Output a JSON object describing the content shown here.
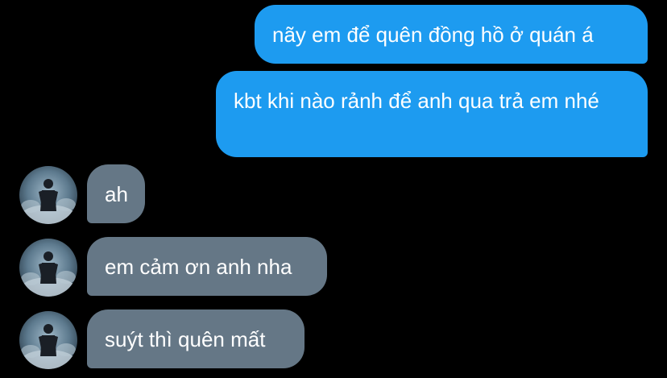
{
  "messages": [
    {
      "direction": "outgoing",
      "text": "nãy em để quên đồng hồ ở quán á"
    },
    {
      "direction": "outgoing",
      "text": "kbt khi nào rảnh để anh qua trả em nhé"
    },
    {
      "direction": "incoming",
      "text": "ah"
    },
    {
      "direction": "incoming",
      "text": "em cảm ơn anh nha"
    },
    {
      "direction": "incoming",
      "text": "suýt thì quên mất"
    }
  ],
  "avatar_icon": "user-avatar-icon",
  "colors": {
    "background": "#000000",
    "outgoing_bubble": "#1d9bf0",
    "incoming_bubble": "#657786",
    "text": "#ffffff"
  }
}
